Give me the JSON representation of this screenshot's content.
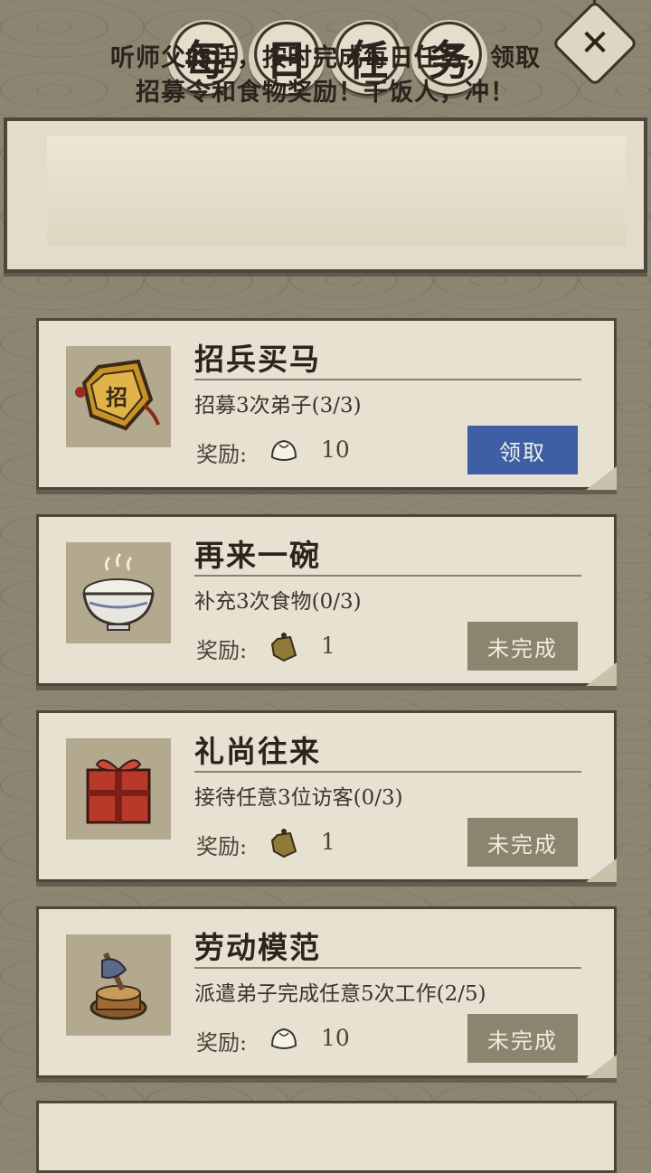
{
  "title": {
    "chars": [
      "每",
      "日",
      "任",
      "务"
    ]
  },
  "close": {
    "glyph": "✕"
  },
  "banner": {
    "text_line1": "听师父的话，按时完成每日任务，领取",
    "text_line2": "招募令和食物奖励！干饭人，冲！"
  },
  "reward_label": "奖励:",
  "tasks": [
    {
      "title": "招兵买马",
      "desc": "招募3次弟子(3/3)",
      "reward_icon": "dumpling-icon",
      "reward_count": "10",
      "button": "领取",
      "button_state": "claim"
    },
    {
      "title": "再来一碗",
      "desc": "补充3次食物(0/3)",
      "reward_icon": "recruit-token-icon",
      "reward_count": "1",
      "button": "未完成",
      "button_state": "pending"
    },
    {
      "title": "礼尚往来",
      "desc": "接待任意3位访客(0/3)",
      "reward_icon": "recruit-token-icon",
      "reward_count": "1",
      "button": "未完成",
      "button_state": "pending"
    },
    {
      "title": "劳动模范",
      "desc": "派遣弟子完成任意5次工作(2/5)",
      "reward_icon": "dumpling-icon",
      "reward_count": "10",
      "button": "未完成",
      "button_state": "pending"
    }
  ],
  "colors": {
    "claim_button": "#3e5ea5",
    "pending_button": "#8d8470",
    "background": "#8b8571",
    "card": "#e6e1d1"
  }
}
